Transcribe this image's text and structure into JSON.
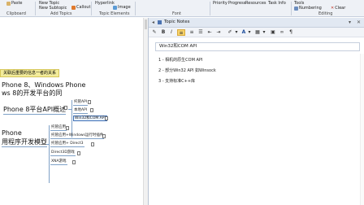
{
  "ribbon": {
    "groups": [
      {
        "name": "Clipboard",
        "controls": [
          "Paste"
        ]
      },
      {
        "name": "Add Topics",
        "controls": [
          "New Topic",
          "New Subtopic",
          "Callout"
        ]
      },
      {
        "name": "Topic Elements",
        "controls": [
          "Hyperlink",
          "Image"
        ]
      },
      {
        "name": "Font",
        "controls": []
      },
      {
        "name": "",
        "controls": [
          "Priority",
          "Progress",
          "Resources",
          "Task Info"
        ]
      },
      {
        "name": "Editing",
        "controls": [
          "Tools",
          "Numbering",
          "Clear"
        ]
      }
    ]
  },
  "map": {
    "callout": "关联后重要的信息一者的关系",
    "topics": [
      "Phone 8、Windows Phone",
      "ws 8的开发平台的同",
      "Phone 8平台API概述",
      "Phone",
      "用程序开发模型"
    ],
    "api_subtopics": [
      "托管API",
      "本地API",
      "Win32和COM API"
    ],
    "model_subtopics": [
      "托管应用",
      "托管应用+Windows运行时插件",
      "托管应用+ Direct3",
      "Direct3D游戏",
      "XNA游戏"
    ]
  },
  "notes": {
    "panel_title": "Topic Notes",
    "subject": "Win32和COM API",
    "items": [
      "1 - 相机的原生COM API",
      "2 - 部分Win32 API 如Winsock",
      "3 - 支持标准C++库"
    ]
  },
  "colors": {
    "highlight": "#f7d36a",
    "callout": "#f3ec9b",
    "connector": "#7fa1c7",
    "selection": "#3d6fb6"
  }
}
